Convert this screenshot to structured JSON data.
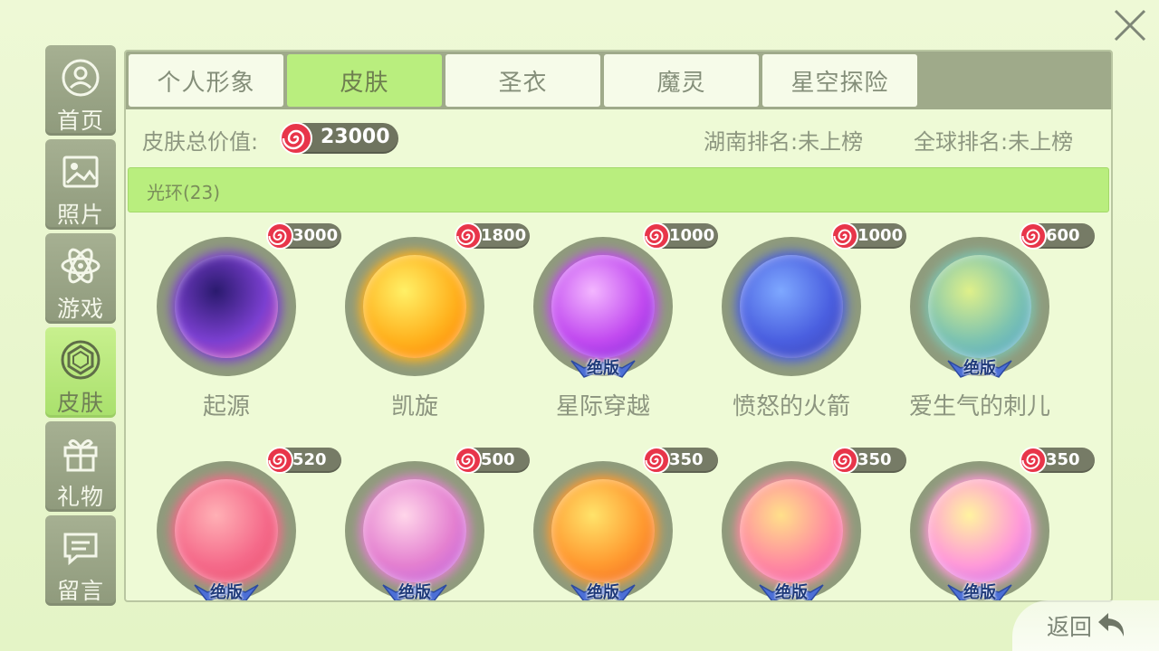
{
  "sidebar": {
    "items": [
      {
        "label": "首页",
        "icon": "profile-icon",
        "active": false
      },
      {
        "label": "照片",
        "icon": "photo-icon",
        "active": false
      },
      {
        "label": "游戏",
        "icon": "atom-icon",
        "active": false
      },
      {
        "label": "皮肤",
        "icon": "gem-icon",
        "active": true
      },
      {
        "label": "礼物",
        "icon": "gift-icon",
        "active": false
      },
      {
        "label": "留言",
        "icon": "message-icon",
        "active": false
      }
    ]
  },
  "tabs": [
    {
      "label": "个人形象"
    },
    {
      "label": "皮肤"
    },
    {
      "label": "圣衣"
    },
    {
      "label": "魔灵"
    },
    {
      "label": "星空探险"
    }
  ],
  "stats": {
    "total_label": "皮肤总价值:",
    "total_value": "23000",
    "province_rank": "湖南排名:未上榜",
    "global_rank": "全球排名:未上榜"
  },
  "section": {
    "title": "光环(23)"
  },
  "items": [
    {
      "name": "起源",
      "price": "3000",
      "limited": false,
      "colors": [
        "#2a1a6e",
        "#7b3fd0",
        "#e64fb0"
      ]
    },
    {
      "name": "凯旋",
      "price": "1800",
      "limited": false,
      "colors": [
        "#fff066",
        "#ffb21e",
        "#ff7a00"
      ]
    },
    {
      "name": "星际穿越",
      "price": "1000",
      "limited": true,
      "colors": [
        "#f3b6ff",
        "#c24bf0",
        "#7b22d8"
      ]
    },
    {
      "name": "愤怒的火箭",
      "price": "1000",
      "limited": false,
      "colors": [
        "#7ea8ff",
        "#4a5fe0",
        "#3b3fb0"
      ]
    },
    {
      "name": "爱生气的刺儿",
      "price": "600",
      "limited": true,
      "colors": [
        "#dff08a",
        "#7dc3b0",
        "#4aa0d0"
      ]
    },
    {
      "name": "",
      "price": "520",
      "limited": true,
      "colors": [
        "#ffb0b5",
        "#f56a8a",
        "#e84a6a"
      ]
    },
    {
      "name": "",
      "price": "500",
      "limited": true,
      "colors": [
        "#ffd6ea",
        "#e480d0",
        "#b85be0"
      ]
    },
    {
      "name": "",
      "price": "350",
      "limited": true,
      "colors": [
        "#ffe36a",
        "#ff9a30",
        "#f06020"
      ]
    },
    {
      "name": "",
      "price": "350",
      "limited": true,
      "colors": [
        "#ffe08a",
        "#ff8aa0",
        "#f050b0"
      ]
    },
    {
      "name": "",
      "price": "350",
      "limited": true,
      "colors": [
        "#fff3a0",
        "#ff9ad8",
        "#c060f0"
      ]
    }
  ],
  "limited_badge": "绝版",
  "back": {
    "label": "返回"
  },
  "colors": {
    "accent_green": "#b9ee7e",
    "sidebar_grey": "#9aa588",
    "candy_red": "#e8354a"
  }
}
